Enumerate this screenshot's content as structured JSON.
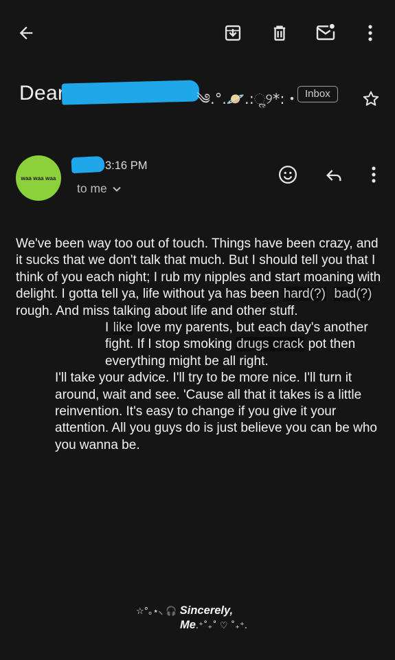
{
  "toolbar": {
    "back_icon": "arrow-left-icon",
    "archive_icon": "archive-icon",
    "delete_icon": "trash-icon",
    "mark_unread_icon": "mail-unread-icon",
    "more_icon": "more-vertical-icon"
  },
  "subject": {
    "prefix": "Dear",
    "decoration": "༄.°.🪐.:ૢ୨*:・",
    "label": "Inbox",
    "star_icon": "star-outline-icon"
  },
  "sender": {
    "avatar_text": "waa waa waa",
    "avatar_color": "#8cd13b",
    "time": "3:16 PM",
    "recipient": "to me",
    "emoji_icon": "emoji-react-icon",
    "reply_icon": "reply-icon",
    "more_icon": "more-vertical-icon"
  },
  "body": {
    "p1_a": "We've been way too out of touch. Things have been crazy, and it sucks that we don't talk that much. But I should tell you that I think of you each night; I rub my nipples and start moaning with delight. I gotta tell ya, life without ya has been ",
    "p1_hl1": "hard(?)",
    "p1_hl2": "bad(?)",
    "p1_b": " rough. And miss talking about life and other stuff.",
    "p2_hl1": "like",
    "p2_a": " love my parents, but each day's another fight. If I stop smoking ",
    "p2_hl2": "drugs crack",
    "p2_b": " pot then everything might be all right.",
    "p3": "I'll take your advice. I'll try to be more nice. I'll turn it around, wait and see. 'Cause all that it takes is a little reinvention. It's easy to change if you give it your attention. All you guys do is just believe you can be who you wanna be."
  },
  "signoff": {
    "pre": "☆°｡⋆⸜ 🎧 ",
    "word": "Sincerely,",
    "name": "Me",
    "post": ".⁺˚₊˚ ♡ ˚₊⁺."
  },
  "colors": {
    "background": "#151515",
    "redaction": "#1fa7ea",
    "highlight": "#0c0c0c"
  }
}
